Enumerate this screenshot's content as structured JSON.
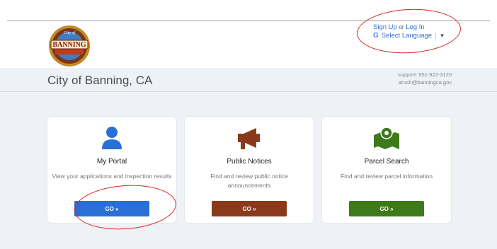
{
  "header": {
    "logo": {
      "text_top": "City of",
      "text_main": "BANNING"
    },
    "auth": {
      "sign_up": "Sign Up",
      "or": "or",
      "log_in": "Log In"
    },
    "language": {
      "google_glyph": "G",
      "label": "Select Language",
      "arrow": "▼"
    }
  },
  "band": {
    "site_title": "City of Banning, CA",
    "support_line": "support: 951-922-3120",
    "support_email": "arush@banningca.gov"
  },
  "cards": [
    {
      "title": "My Portal",
      "desc": "View your applications and inspection results",
      "button": "GO »",
      "color": "#2a6fd6",
      "icon": "user-icon"
    },
    {
      "title": "Public Notices",
      "desc": "Find and review public notice announcements",
      "button": "GO »",
      "color": "#8a3a1a",
      "icon": "megaphone-icon"
    },
    {
      "title": "Parcel Search",
      "desc": "Find and review parcel information",
      "button": "GO »",
      "color": "#3e7a1a",
      "icon": "map-pin-icon"
    }
  ],
  "colors": {
    "annotation": "#d8232a",
    "link": "#2f6fd0"
  }
}
